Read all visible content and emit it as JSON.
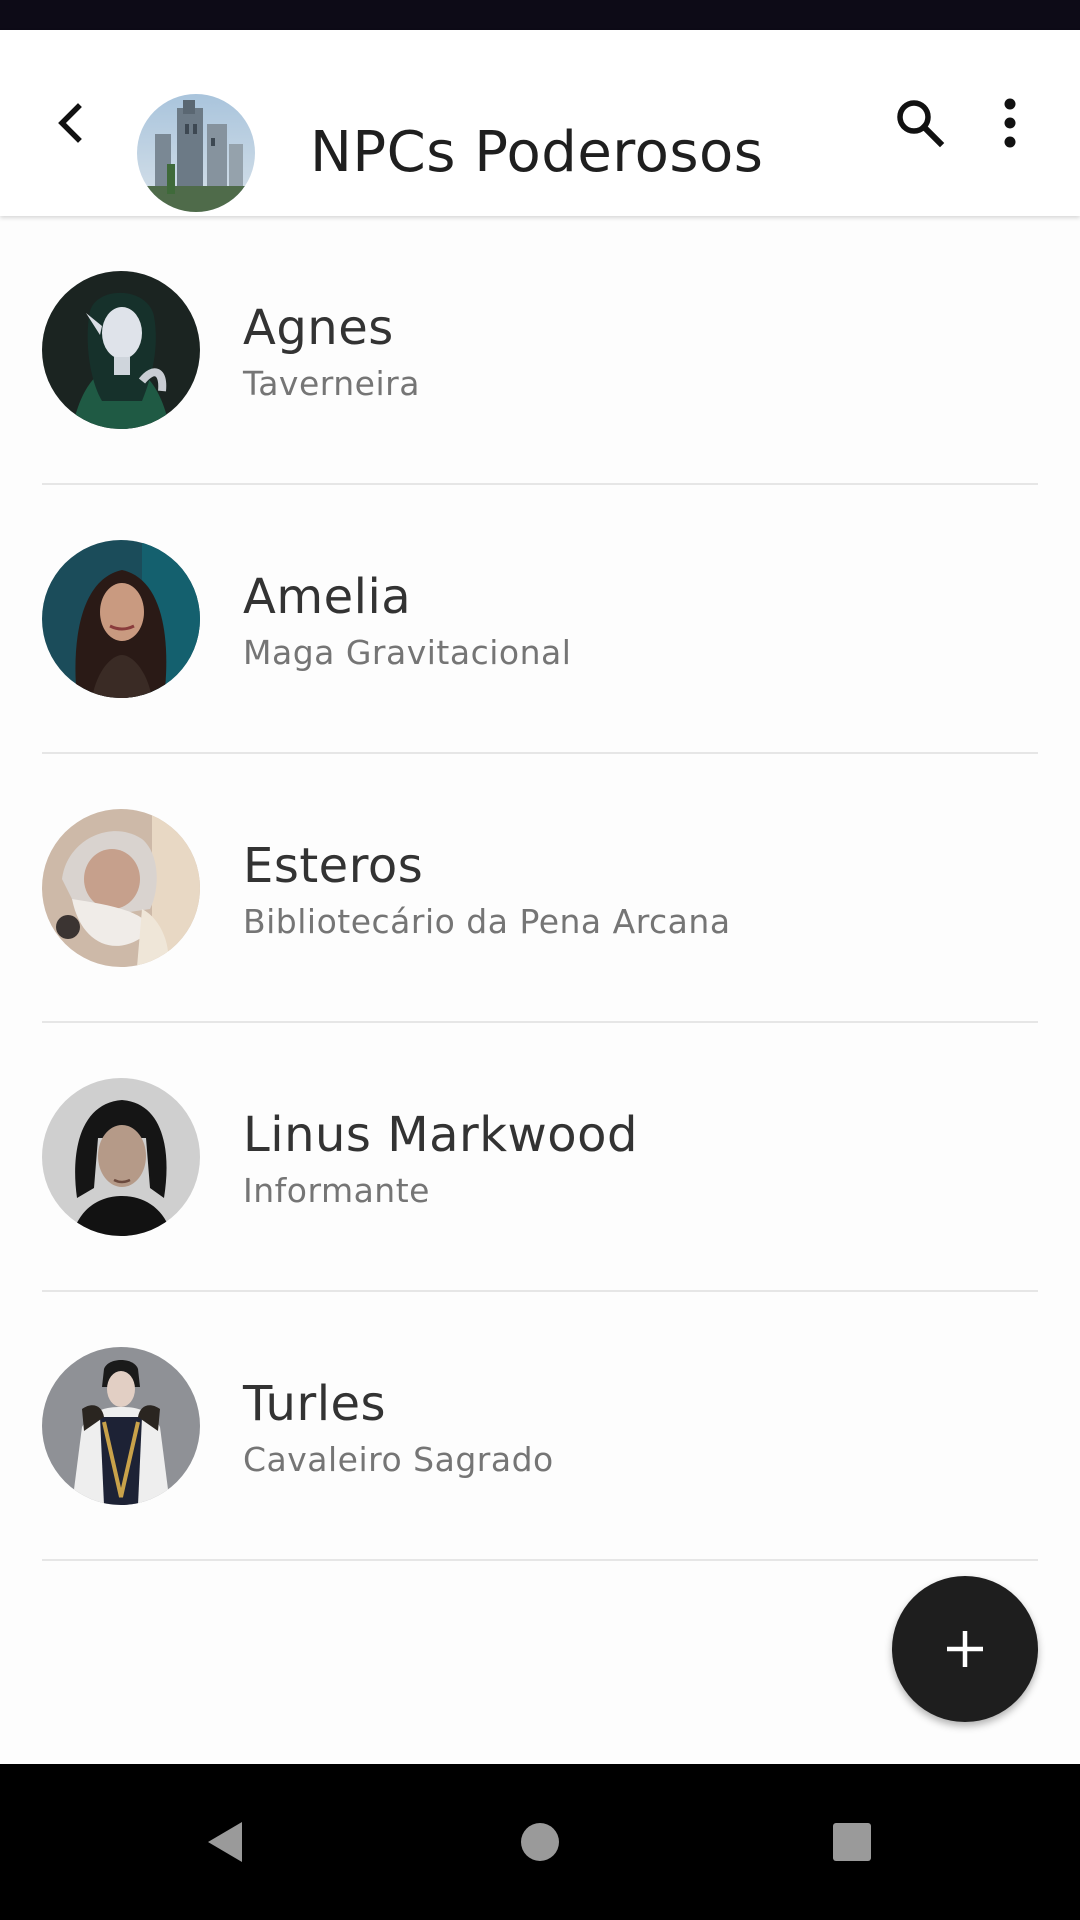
{
  "app_bar": {
    "title": "NPCs Poderosos",
    "back_icon": "arrow-back-icon",
    "search_icon": "search-icon",
    "more_icon": "more-vert-icon",
    "avatar": "castle-avatar"
  },
  "npcs": [
    {
      "name": "Agnes",
      "role": "Taverneira"
    },
    {
      "name": "Amelia",
      "role": "Maga Gravitacional"
    },
    {
      "name": "Esteros",
      "role": "Bibliotecário da Pena Arcana"
    },
    {
      "name": "Linus Markwood",
      "role": "Informante"
    },
    {
      "name": "Turles",
      "role": "Cavaleiro Sagrado"
    }
  ],
  "fab": {
    "icon": "add-icon"
  },
  "nav_bar": {
    "back_icon": "nav-back-icon",
    "home_icon": "nav-home-icon",
    "recents_icon": "nav-recents-icon"
  },
  "colors": {
    "status_bar": "#0d0b17",
    "fab": "#1e1e1e",
    "nav_bar": "#000000",
    "title": "#1f1f1f",
    "name": "#333333",
    "role": "#757575"
  }
}
